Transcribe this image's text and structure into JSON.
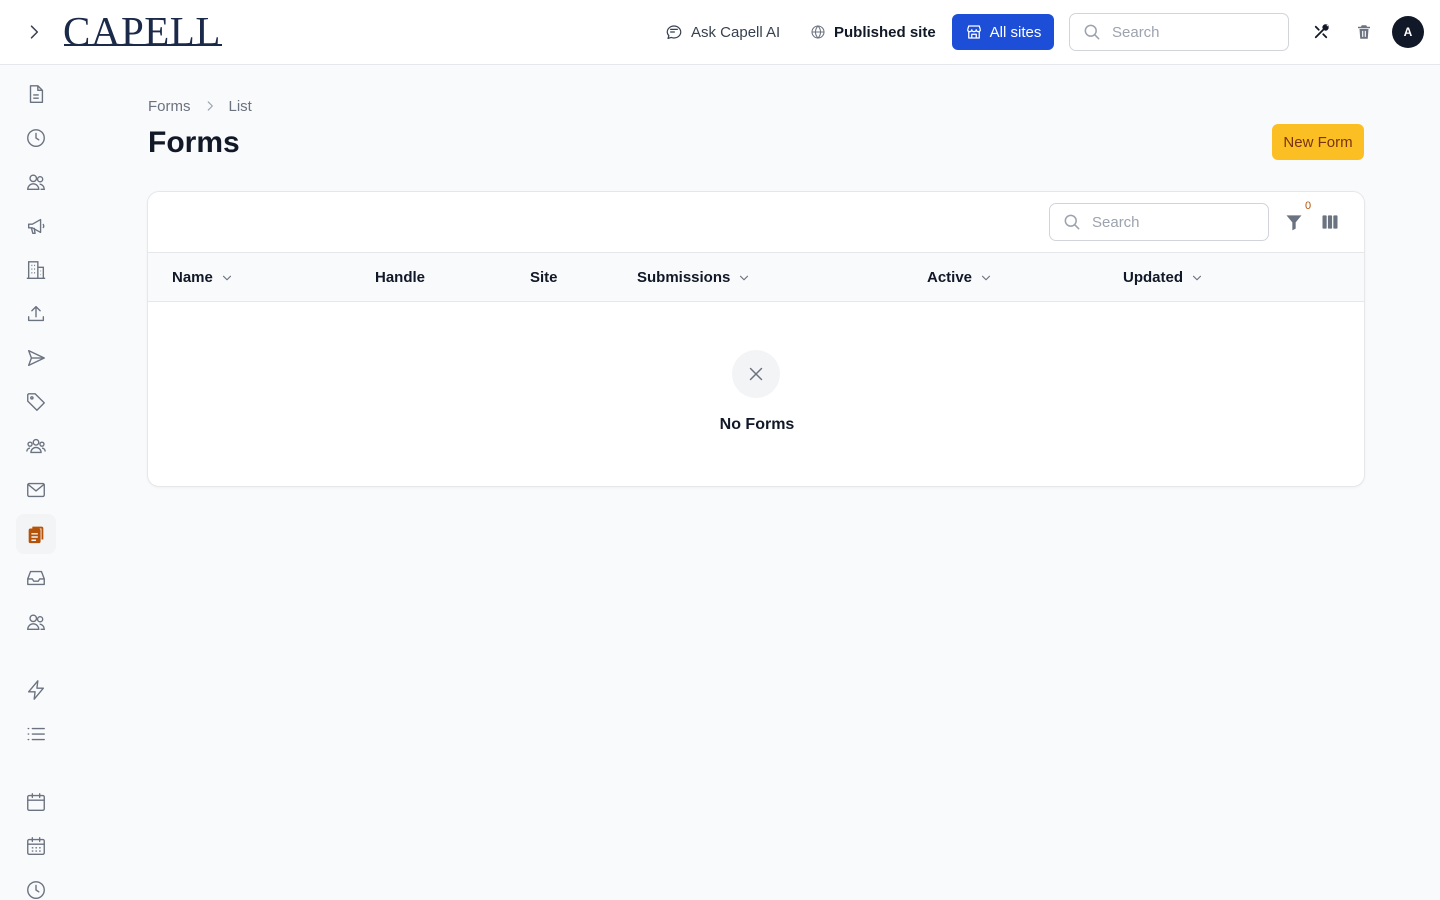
{
  "header": {
    "logo_text": "CAPELL",
    "ask_ai_label": "Ask Capell AI",
    "published_site_label": "Published site",
    "all_sites_label": "All sites",
    "search_placeholder": "Search",
    "avatar_initial": "A"
  },
  "sidebar": {
    "items": [
      {
        "icon": "document-icon"
      },
      {
        "icon": "clock-icon"
      },
      {
        "icon": "users-icon"
      },
      {
        "icon": "megaphone-icon"
      },
      {
        "icon": "building-icon"
      },
      {
        "icon": "upload-icon"
      },
      {
        "icon": "send-icon"
      },
      {
        "icon": "tag-icon"
      },
      {
        "icon": "user-group-icon"
      },
      {
        "icon": "mail-icon"
      },
      {
        "icon": "forms-icon",
        "active": true
      },
      {
        "icon": "inbox-icon"
      },
      {
        "icon": "users-icon"
      },
      {
        "icon": "bolt-icon"
      },
      {
        "icon": "list-icon"
      },
      {
        "icon": "calendar-icon"
      },
      {
        "icon": "calendar-days-icon"
      },
      {
        "icon": "clock-icon"
      }
    ],
    "active_color": "#b45309"
  },
  "breadcrumb": {
    "items": [
      "Forms",
      "List"
    ]
  },
  "page": {
    "title": "Forms",
    "new_button_label": "New Form"
  },
  "table": {
    "search_placeholder": "Search",
    "filter_count": "0",
    "columns": [
      {
        "label": "Name",
        "sortable": true
      },
      {
        "label": "Handle",
        "sortable": false
      },
      {
        "label": "Site",
        "sortable": false
      },
      {
        "label": "Submissions",
        "sortable": true
      },
      {
        "label": "Active",
        "sortable": true
      },
      {
        "label": "Updated",
        "sortable": true
      }
    ],
    "rows": [],
    "empty_message": "No Forms"
  },
  "colors": {
    "primary": "#1d4ed8",
    "accent": "#fbbf24",
    "accent_text": "#78350f"
  }
}
